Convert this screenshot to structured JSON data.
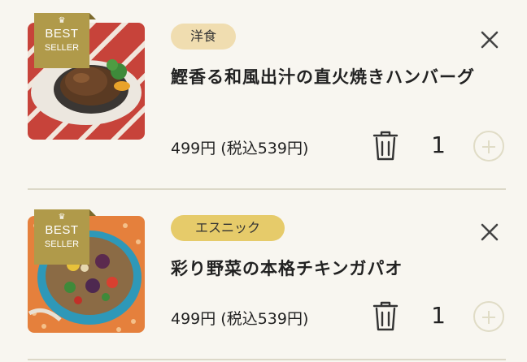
{
  "cart": {
    "items": [
      {
        "badge": {
          "line1": "BEST",
          "line2": "SELLER",
          "icon": "crown-icon"
        },
        "category": "洋食",
        "title": "鰹香る和風出汁の直火焼きハンバーグ",
        "price": "499円 (税込539円)",
        "quantity": "1",
        "image": "hamburg-steak-photo"
      },
      {
        "badge": {
          "line1": "BEST",
          "line2": "SELLER",
          "icon": "crown-icon"
        },
        "category": "エスニック",
        "title": "彩り野菜の本格チキンガパオ",
        "price": "499円 (税込539円)",
        "quantity": "1",
        "image": "chicken-gapao-photo"
      }
    ]
  },
  "colors": {
    "background": "#f8f6f0",
    "badge": "#b09a4a",
    "tag_western": "#f0ddb0",
    "tag_ethnic": "#e6cb6a",
    "divider": "#dcd8c8"
  }
}
